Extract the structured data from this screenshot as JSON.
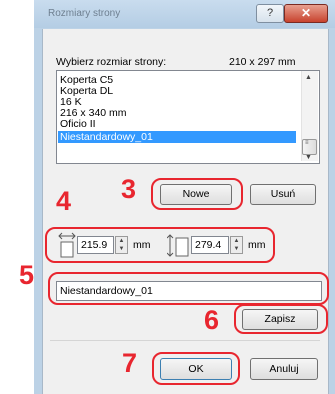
{
  "window": {
    "title": "Rozmiary strony",
    "help_symbol": "?",
    "close_symbol": "✕"
  },
  "page_size": {
    "label": "Wybierz rozmiar strony:",
    "current_size": "210 x 297 mm"
  },
  "size_list": {
    "items": [
      "Koperta C5",
      "Koperta DL",
      "16 K",
      "216 x 340 mm",
      "Oficio II",
      "Niestandardowy_01"
    ],
    "selected": "Niestandardowy_01"
  },
  "buttons": {
    "new_label": "Nowe",
    "delete_label": "Usuń",
    "save_label": "Zapisz",
    "ok_label": "OK",
    "cancel_label": "Anuluj"
  },
  "dimensions": {
    "width_value": "215.9",
    "width_unit": "mm",
    "height_value": "279.4",
    "height_unit": "mm"
  },
  "name_field": {
    "value": "Niestandardowy_01"
  },
  "step_markers": {
    "three": "3",
    "four": "4",
    "five": "5",
    "six": "6",
    "seven": "7"
  },
  "colors": {
    "marker_red": "#e8262f",
    "selection_blue": "#3399ff"
  }
}
